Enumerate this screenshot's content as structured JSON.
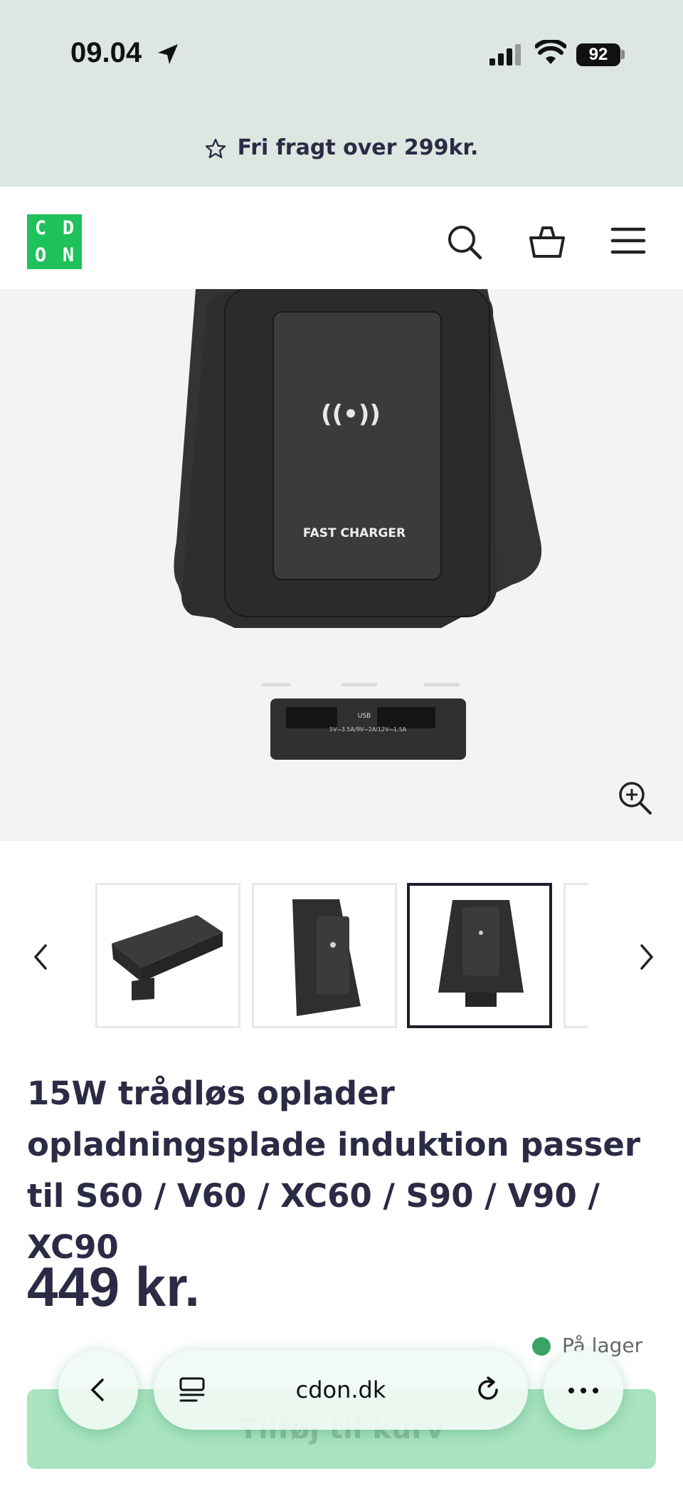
{
  "status_bar": {
    "time": "09.04",
    "battery": "92"
  },
  "promo": {
    "text": "Fri fragt over 299kr."
  },
  "header": {
    "logo_letters": [
      "C",
      "D",
      "O",
      "N"
    ]
  },
  "product": {
    "image_labels": {
      "charger": "FAST CHARGER",
      "usb": "USB",
      "ports": "5V⎓3.5A/9V⎓2A/12V⎓1.5A"
    },
    "title": "15W trådløs oplader opladningsplade induktion passer til S60 / V60 / XC60 / S90 / V90 / XC90",
    "price": "449 kr.",
    "stock": "På lager",
    "add_to_cart": "Tilføj til kurv"
  },
  "browser": {
    "url": "cdon.dk"
  },
  "colors": {
    "brand_green": "#1ec25a",
    "promo_bg": "#dde6e0",
    "text_dark": "#2b2b45",
    "stock_green": "#3aa464"
  }
}
